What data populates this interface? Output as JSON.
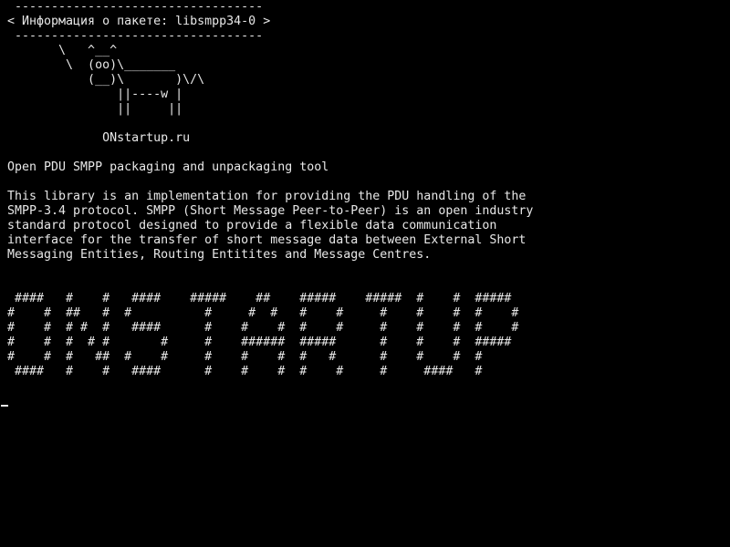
{
  "terminal": {
    "foreground": "#e8e8e8",
    "background": "#000000",
    "lines": [
      " ----------------------------------",
      "< Информация о пакете: libsmpp34-0 >",
      " ----------------------------------",
      "       \\   ^__^",
      "        \\  (oo)\\_______",
      "           (__)\\       )\\/\\",
      "               ||----w |",
      "               ||     ||",
      "",
      "             ONstartup.ru",
      "",
      "Open PDU SMPP packaging and unpackaging tool",
      "",
      "This library is an implementation for providing the PDU handling of the",
      "SMPP-3.4 protocol. SMPP (Short Message Peer-to-Peer) is an open industry",
      "standard protocol designed to provide a flexible data communication",
      "interface for the transfer of short message data between External Short",
      "Messaging Entities, Routing Entitites and Message Centres.",
      "",
      "",
      " ####   #    #   ####    #####    ##    #####    #####  #    #  #####",
      "#    #  ##   #  #          #     #  #   #    #     #    #    #  #    #",
      "#    #  # #  #   ####      #    #    #  #    #     #    #    #  #    #",
      "#    #  #  # #       #     #    ######  #####      #    #    #  #####",
      "#    #  #   ##  #    #     #    #    #  #   #      #    #    #  #",
      " ####   #    #   ####      #    #    #  #    #     #     ####   #"
    ]
  }
}
